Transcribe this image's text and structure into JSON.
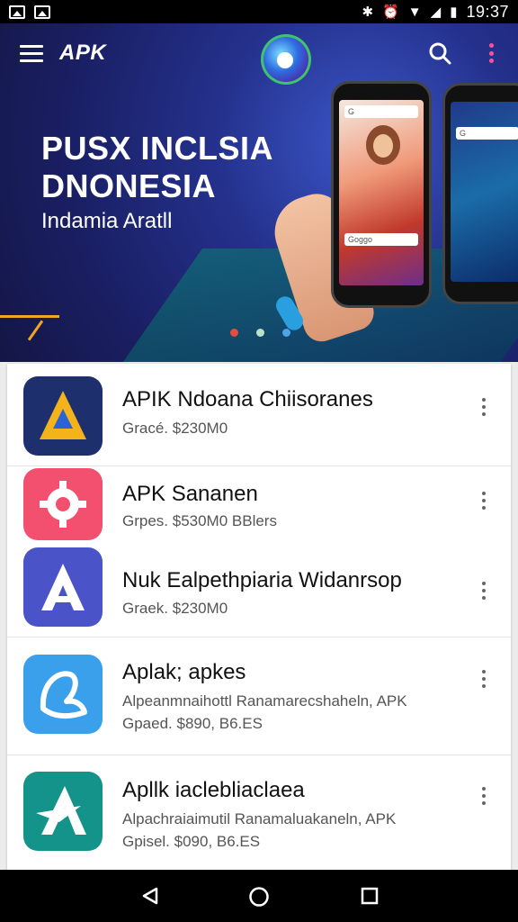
{
  "status_bar": {
    "time": "19:37",
    "icons": [
      "image-icon",
      "photo-icon",
      "bluetooth-icon",
      "alarm-icon",
      "wifi-icon",
      "signal-icon",
      "battery-icon"
    ]
  },
  "toolbar": {
    "title": "APK",
    "icons": [
      "menu-icon",
      "app-logo",
      "search-icon",
      "overflow-menu-icon"
    ]
  },
  "hero": {
    "title_line1": "PUSX INCLSIA",
    "title_line2": "DNONESIA",
    "subtitle": "Indamia Aratll",
    "search_text": "G",
    "search_text2": "Goggo",
    "carousel_dots": [
      {
        "color": "#e84b3c",
        "active": true
      },
      {
        "color": "#b9e3c6",
        "active": false
      },
      {
        "color": "#4fa3e8",
        "active": false
      }
    ],
    "accent": "#f2a51e"
  },
  "apps": [
    {
      "name": "APIK Ndoana Chiisoranes",
      "meta": "Gracé. $230M0",
      "desc": "",
      "icon": "triangle-a-icon",
      "bg": "#1e2f6e",
      "fg": "#f4b21b"
    },
    {
      "name": "APK Sananen",
      "meta": "Grpes. $530M0 BBlers",
      "desc": "",
      "icon": "gear-icon",
      "bg": "#f2506e",
      "fg": "#ffffff"
    },
    {
      "name": "Nuk Ealpethpiaria Widanrsop",
      "meta": "Graek. $230M0",
      "desc": "",
      "icon": "letter-a-icon",
      "bg": "#4a54c8",
      "fg": "#ffffff"
    },
    {
      "name": "Aplak; apkes",
      "desc": "Alpeanmnaihottl Ranamarecshaheln, APK",
      "meta": "Gpaed. $890, B6.ES",
      "icon": "leaf-icon",
      "bg": "#3aa0ec",
      "fg": "#ffffff"
    },
    {
      "name": "Apllk iaclebliaclaea",
      "desc": "Alpachraiaimutil Ranamaluakaneln, APK",
      "meta": "Gpisel. $090, B6.ES",
      "icon": "star-a-icon",
      "bg": "#14938a",
      "fg": "#ffffff"
    }
  ],
  "nav_bar": {
    "buttons": [
      "back-icon",
      "home-icon",
      "recents-icon"
    ]
  }
}
